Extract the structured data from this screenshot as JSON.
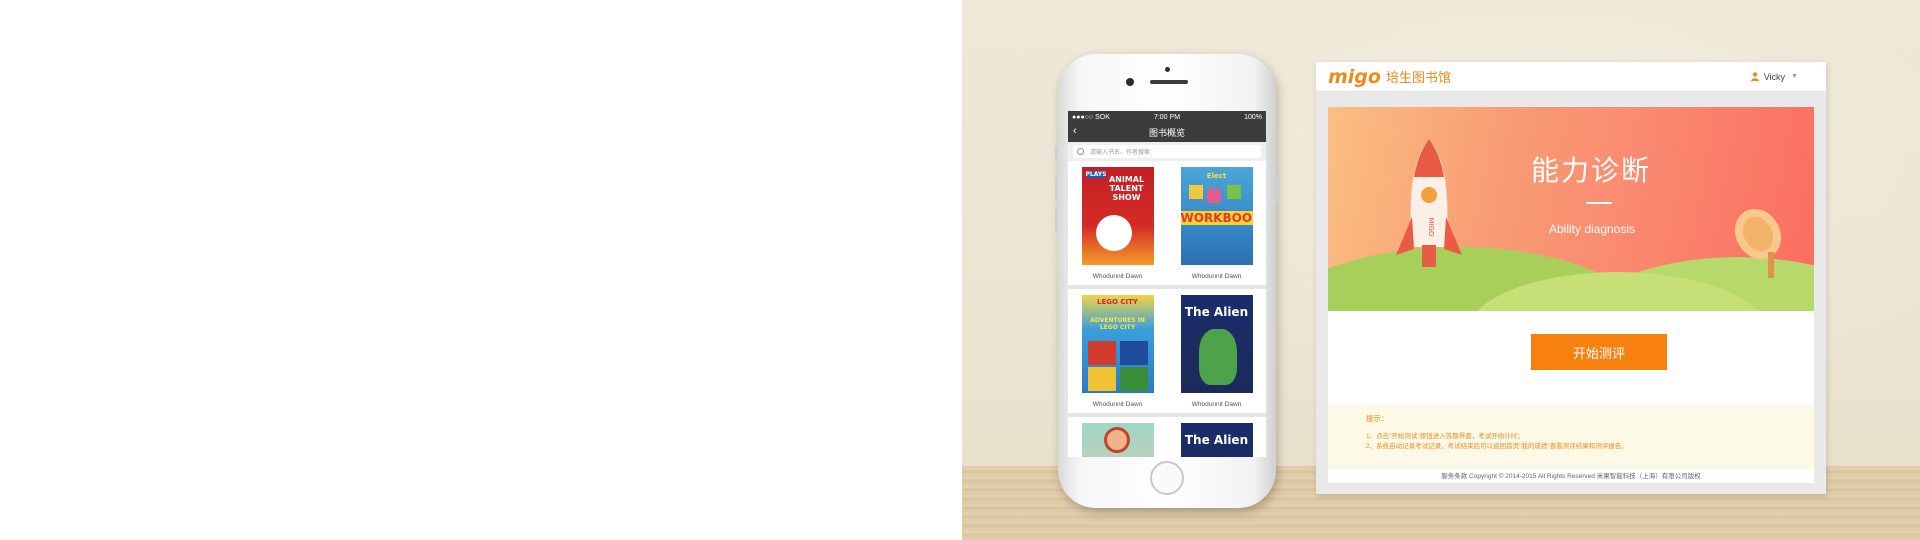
{
  "phone": {
    "status_left": "●●●○○ SOK",
    "status_time": "7:00 PM",
    "status_right": "100%",
    "nav_title": "图书概览",
    "back_glyph": "‹",
    "search_placeholder": "请输入书名、作者搜索",
    "books": [
      {
        "title": "Whodunnit Dawn",
        "cover_text": "ANIMAL TALENT SHOW",
        "badge": "PLAYS"
      },
      {
        "title": "Whodunnit Dawn",
        "cover_text": "WORKBOOK",
        "badge": "Elect"
      },
      {
        "title": "Whodunnit Dawn",
        "cover_text": "ADVENTURES IN LEGO CITY",
        "badge": "LEGO CITY"
      },
      {
        "title": "Whodunnit Dawn",
        "cover_text": "The Alien",
        "badge": ""
      },
      {
        "title": "",
        "cover_text": "",
        "badge": ""
      },
      {
        "title": "",
        "cover_text": "The Alien",
        "badge": ""
      }
    ]
  },
  "web": {
    "logo": "migo",
    "brand": "培生图书馆",
    "user": "Vicky",
    "banner_title": "能力诊断",
    "banner_subtitle": "Ability diagnosis",
    "rocket_text": "MIGO",
    "start_button": "开始测评",
    "tips_title": "提示：",
    "tips": [
      "1、点击\"开始测试\"按钮进入答题界面，考试开始计时；",
      "2、系统自动记录考试记录，考试结束后可以返回首页\"我的成绩\"查看测评结果和测评报告。"
    ],
    "footer": "服务条款 Copyright © 2014-2015 All Rights Reserved 米果智能科技（上海）有限公司版权"
  },
  "colors": {
    "accent": "#f7800f",
    "brand_orange": "#f08a1c",
    "nav_dark": "#3c3c3c"
  }
}
